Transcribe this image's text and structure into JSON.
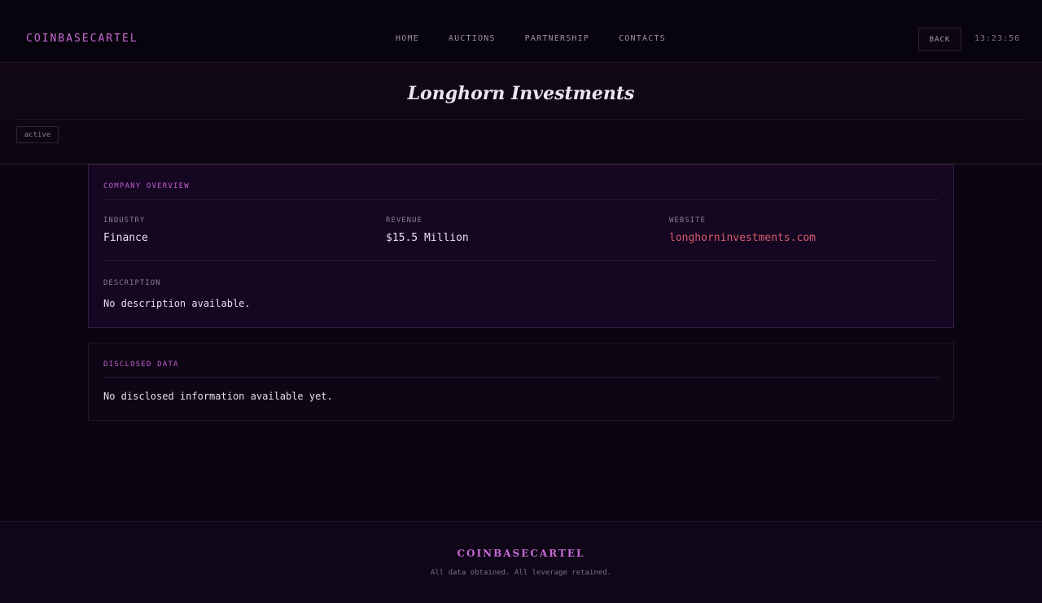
{
  "header": {
    "brand": "COINBASECARTEL",
    "nav": [
      "HOME",
      "AUCTIONS",
      "PARTNERSHIP",
      "CONTACTS"
    ],
    "back_label": "BACK",
    "clock": "13:23:56"
  },
  "hero": {
    "title": "Longhorn Investments",
    "status": "active"
  },
  "overview": {
    "title": "COMPANY OVERVIEW",
    "industry_label": "INDUSTRY",
    "industry_value": "Finance",
    "revenue_label": "REVENUE",
    "revenue_value": "$15.5 Million",
    "website_label": "WEBSITE",
    "website_value": "longhorninvestments.com",
    "description_label": "DESCRIPTION",
    "description_value": "No description available."
  },
  "disclosed": {
    "title": "DISCLOSED DATA",
    "text": "No disclosed information available yet."
  },
  "footer": {
    "brand": "COINBASECARTEL",
    "tagline": "All data obtained. All leverage retained."
  },
  "colors": {
    "accent": "#c76bd6",
    "link": "#d85e6a",
    "background": "#0a0510"
  }
}
